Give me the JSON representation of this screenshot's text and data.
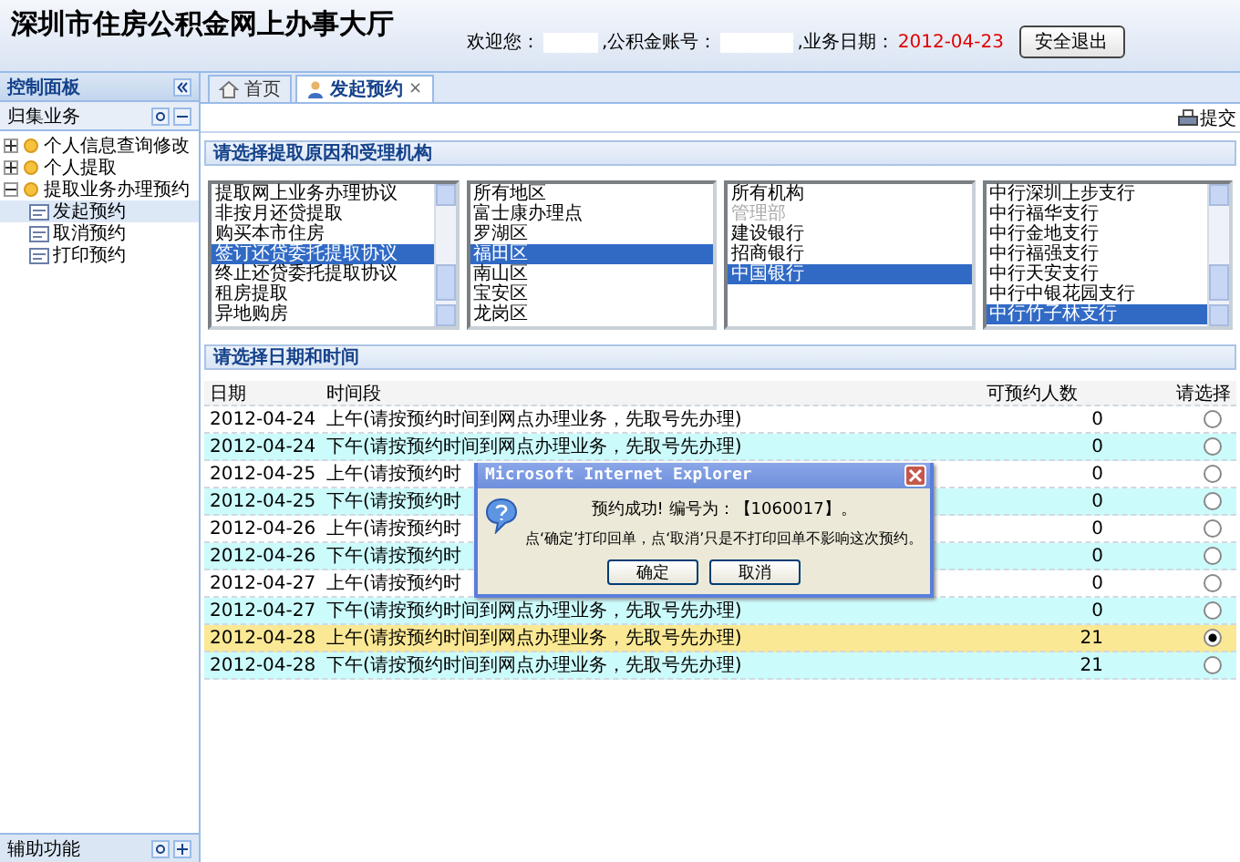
{
  "header": {
    "title": "深圳市住房公积金网上办事大厅",
    "welcome_label": "欢迎您：",
    "account_label": ",公积金账号：",
    "date_label": ",业务日期：",
    "date": "2012-04-23",
    "logout_button": "安全退出"
  },
  "sidebar": {
    "title": "控制面板",
    "section": "归集业务",
    "footer": "辅助功能",
    "tree": [
      {
        "label": "个人信息查询修改",
        "expanded": false
      },
      {
        "label": "个人提取",
        "expanded": false
      },
      {
        "label": "提取业务办理预约",
        "expanded": true,
        "children": [
          {
            "label": "发起预约",
            "selected": true
          },
          {
            "label": "取消预约",
            "selected": false
          },
          {
            "label": "打印预约",
            "selected": false
          }
        ]
      }
    ]
  },
  "tabs": [
    {
      "label": "首页",
      "kind": "home",
      "selected": false
    },
    {
      "label": "发起预约",
      "kind": "person",
      "selected": true,
      "close": "×"
    }
  ],
  "toolbar": {
    "submit": "提交"
  },
  "reason_section": {
    "title": "请选择提取原因和受理机构",
    "lists": [
      {
        "scroll": true,
        "items": [
          {
            "label": "提取网上业务办理协议",
            "selected": false
          },
          {
            "label": "非按月还贷提取",
            "selected": false
          },
          {
            "label": "购买本市住房",
            "selected": false
          },
          {
            "label": "签订还贷委托提取协议",
            "selected": true
          },
          {
            "label": "终止还贷委托提取协议",
            "selected": false
          },
          {
            "label": "租房提取",
            "selected": false
          },
          {
            "label": "异地购房",
            "selected": false
          }
        ]
      },
      {
        "scroll": false,
        "items": [
          {
            "label": "所有地区",
            "selected": false
          },
          {
            "label": "富士康办理点",
            "selected": false
          },
          {
            "label": "罗湖区",
            "selected": false
          },
          {
            "label": "福田区",
            "selected": true
          },
          {
            "label": "南山区",
            "selected": false
          },
          {
            "label": "宝安区",
            "selected": false
          },
          {
            "label": "龙岗区",
            "selected": false
          }
        ]
      },
      {
        "scroll": false,
        "items": [
          {
            "label": "所有机构",
            "selected": false
          },
          {
            "label": "管理部",
            "selected": false,
            "disabled": true
          },
          {
            "label": "建设银行",
            "selected": false
          },
          {
            "label": "招商银行",
            "selected": false
          },
          {
            "label": "中国银行",
            "selected": true
          }
        ]
      },
      {
        "scroll": true,
        "items": [
          {
            "label": "中行深圳上步支行",
            "selected": false
          },
          {
            "label": "中行福华支行",
            "selected": false
          },
          {
            "label": "中行金地支行",
            "selected": false
          },
          {
            "label": "中行福强支行",
            "selected": false
          },
          {
            "label": "中行天安支行",
            "selected": false
          },
          {
            "label": "中行中银花园支行",
            "selected": false
          },
          {
            "label": "中行竹子林支行",
            "selected": true
          }
        ]
      }
    ]
  },
  "time_section": {
    "title": "请选择日期和时间",
    "columns": [
      "日期",
      "时间段",
      "可预约人数",
      "请选择"
    ],
    "rows": [
      {
        "date": "2012-04-24",
        "slot": "上午(请按预约时间到网点办理业务，先取号先办理)",
        "count": "0",
        "selected": false
      },
      {
        "date": "2012-04-24",
        "slot": "下午(请按预约时间到网点办理业务，先取号先办理)",
        "count": "0",
        "selected": false
      },
      {
        "date": "2012-04-25",
        "slot": "上午(请按预约时",
        "count": "0",
        "selected": false
      },
      {
        "date": "2012-04-25",
        "slot": "下午(请按预约时",
        "count": "0",
        "selected": false
      },
      {
        "date": "2012-04-26",
        "slot": "上午(请按预约时",
        "count": "0",
        "selected": false
      },
      {
        "date": "2012-04-26",
        "slot": "下午(请按预约时",
        "count": "0",
        "selected": false
      },
      {
        "date": "2012-04-27",
        "slot": "上午(请按预约时",
        "count": "0",
        "selected": false
      },
      {
        "date": "2012-04-27",
        "slot": "下午(请按预约时间到网点办理业务，先取号先办理)",
        "count": "0",
        "selected": false
      },
      {
        "date": "2012-04-28",
        "slot": "上午(请按预约时间到网点办理业务，先取号先办理)",
        "count": "21",
        "selected": true
      },
      {
        "date": "2012-04-28",
        "slot": "下午(请按预约时间到网点办理业务，先取号先办理)",
        "count": "21",
        "selected": false
      }
    ]
  },
  "dialog": {
    "title": "Microsoft Internet Explorer",
    "message": "预约成功! 编号为：【1060017】。",
    "detail": "点‘确定’打印回单，点‘取消’只是不打印回单不影响这次预约。",
    "buttons": [
      "确定",
      "取消"
    ]
  }
}
